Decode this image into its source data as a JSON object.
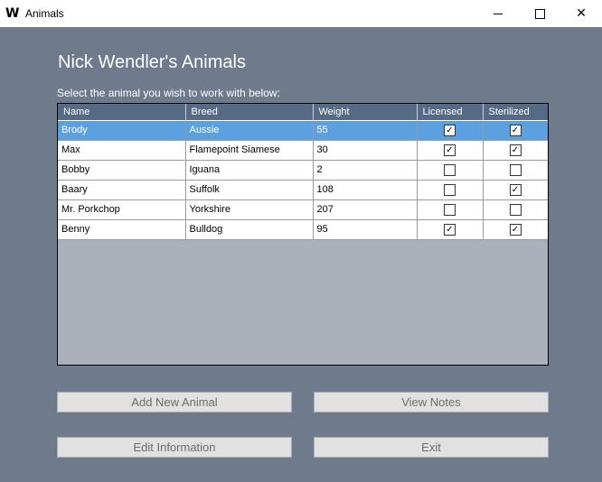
{
  "window": {
    "icon": "W",
    "title": "Animals",
    "minimize_icon": "minimize-icon",
    "maximize_icon": "maximize-icon",
    "close_glyph": "✕"
  },
  "heading": "Nick Wendler's Animals",
  "subheading": "Select the animal you wish to work with below:",
  "grid": {
    "columns": [
      "Name",
      "Breed",
      "Weight",
      "Licensed",
      "Sterilized"
    ],
    "selected_row": 0,
    "rows": [
      {
        "name": "Brody",
        "breed": "Aussie",
        "weight": "55",
        "licensed": true,
        "sterilized": true
      },
      {
        "name": "Max",
        "breed": "Flamepoint Siamese",
        "weight": "30",
        "licensed": true,
        "sterilized": true
      },
      {
        "name": "Bobby",
        "breed": "Iguana",
        "weight": "2",
        "licensed": false,
        "sterilized": false
      },
      {
        "name": "Baary",
        "breed": "Suffolk",
        "weight": "108",
        "licensed": false,
        "sterilized": true
      },
      {
        "name": "Mr. Porkchop",
        "breed": "Yorkshire",
        "weight": "207",
        "licensed": false,
        "sterilized": false
      },
      {
        "name": "Benny",
        "breed": "Bulldog",
        "weight": "95",
        "licensed": true,
        "sterilized": true
      }
    ]
  },
  "buttons": {
    "add": "Add New Animal",
    "notes": "View Notes",
    "edit": "Edit Information",
    "exit": "Exit"
  },
  "colors": {
    "background": "#6d7b8d",
    "header": "#556a85",
    "selection": "#5ca0e0",
    "grid_empty": "#abb0bb"
  }
}
